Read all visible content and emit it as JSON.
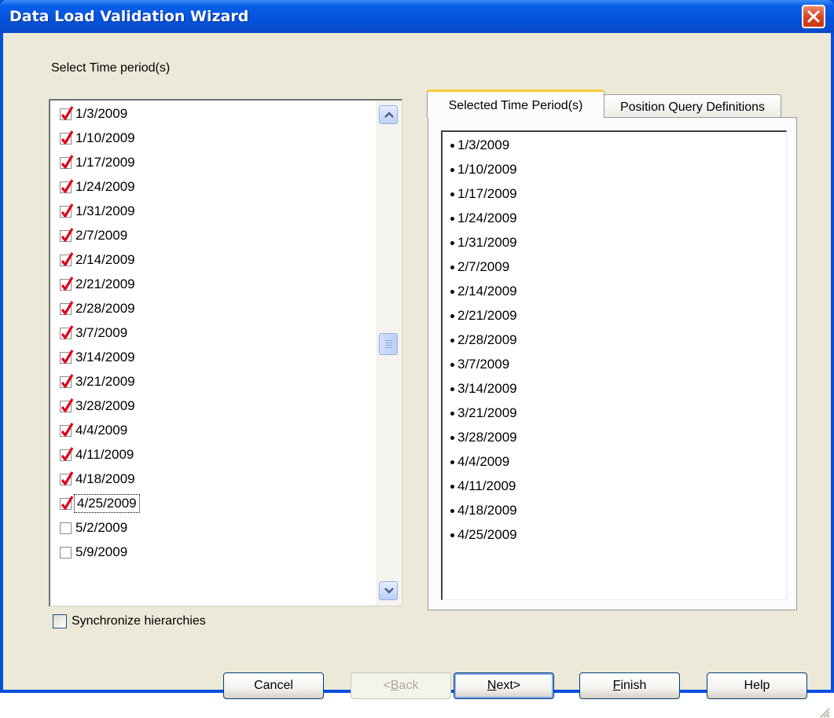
{
  "window": {
    "title": "Data Load Validation Wizard"
  },
  "left_panel": {
    "label": "Select Time period(s)",
    "items": [
      {
        "label": "1/3/2009",
        "checked": true
      },
      {
        "label": "1/10/2009",
        "checked": true
      },
      {
        "label": "1/17/2009",
        "checked": true
      },
      {
        "label": "1/24/2009",
        "checked": true
      },
      {
        "label": "1/31/2009",
        "checked": true
      },
      {
        "label": "2/7/2009",
        "checked": true
      },
      {
        "label": "2/14/2009",
        "checked": true
      },
      {
        "label": "2/21/2009",
        "checked": true
      },
      {
        "label": "2/28/2009",
        "checked": true
      },
      {
        "label": "3/7/2009",
        "checked": true
      },
      {
        "label": "3/14/2009",
        "checked": true
      },
      {
        "label": "3/21/2009",
        "checked": true
      },
      {
        "label": "3/28/2009",
        "checked": true
      },
      {
        "label": "4/4/2009",
        "checked": true
      },
      {
        "label": "4/11/2009",
        "checked": true
      },
      {
        "label": "4/18/2009",
        "checked": true
      },
      {
        "label": "4/25/2009",
        "checked": true
      },
      {
        "label": "5/2/2009",
        "checked": false
      },
      {
        "label": "5/9/2009",
        "checked": false
      }
    ],
    "sync_label": "Synchronize hierarchies"
  },
  "tabs": [
    {
      "label": "Selected Time Period(s)",
      "active": true
    },
    {
      "label": "Position Query Definitions",
      "active": false
    }
  ],
  "selected_items": [
    "1/3/2009",
    "1/10/2009",
    "1/17/2009",
    "1/24/2009",
    "1/31/2009",
    "2/7/2009",
    "2/14/2009",
    "2/21/2009",
    "2/28/2009",
    "3/7/2009",
    "3/14/2009",
    "3/21/2009",
    "3/28/2009",
    "4/4/2009",
    "4/11/2009",
    "4/18/2009",
    "4/25/2009"
  ],
  "buttons": {
    "cancel": "Cancel",
    "back_prefix": "<",
    "back_key": "B",
    "back_rest": "ack",
    "next_key": "N",
    "next_rest": "ext>",
    "finish_key": "F",
    "finish_rest": "inish",
    "help": "Help"
  },
  "colors": {
    "check": "#e0001b",
    "title_bar": "#0452dc",
    "dialog_bg": "#ece9d8"
  }
}
